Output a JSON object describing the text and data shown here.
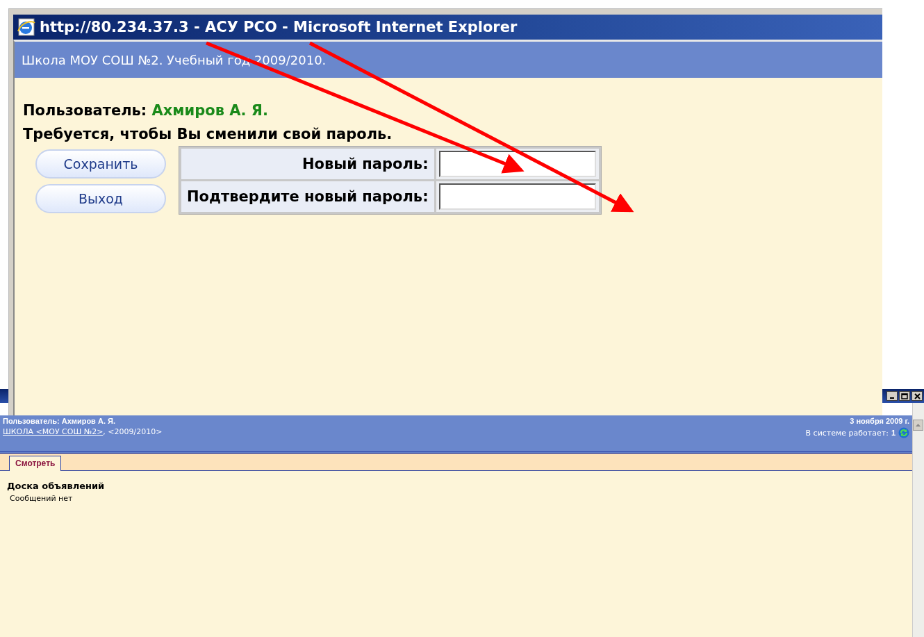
{
  "background_window": {
    "header": {
      "user": "Пользователь: Ахмиров А. Я.",
      "school_link": "ШКОЛА <МОУ СОШ №2>",
      "year": ", <2009/2010>",
      "date": "3 ноября 2009 г.",
      "online_label": "В системе работает:",
      "online_count": "1"
    },
    "tabs": [
      {
        "label": "Смотреть",
        "selected": true
      }
    ],
    "board": {
      "title": "Доска объявлений",
      "message": "Сообщений нет"
    }
  },
  "popup_window": {
    "title": "http://80.234.37.3 - АСУ РСО - Microsoft Internet Explorer",
    "header": "Школа МОУ СОШ №2. Учебный год 2009/2010.",
    "user_label": "Пользователь:",
    "user_name": "Ахмиров А. Я.",
    "prompt": "Требуется, чтобы Вы сменили свой пароль.",
    "buttons": [
      "Сохранить",
      "Выход"
    ],
    "fields": [
      {
        "label": "Новый пароль:"
      },
      {
        "label": "Подтвердите новый пароль:"
      }
    ]
  }
}
